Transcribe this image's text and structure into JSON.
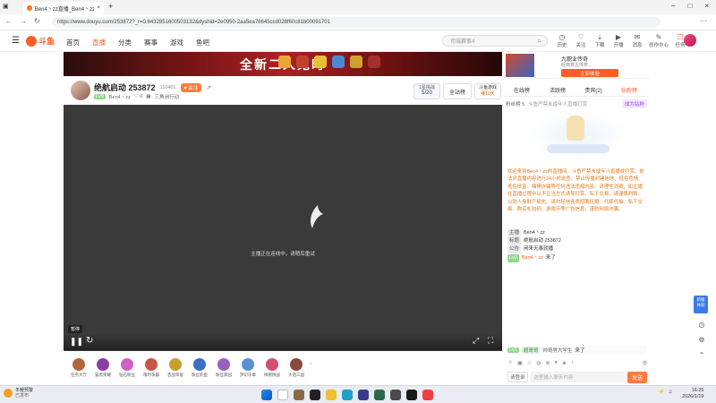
{
  "browser": {
    "tabs": [
      {
        "title": "Ben4丶zz直播_Ben4丶zz直播_Ben4丶",
        "active": true
      }
    ],
    "url": "https://www.douyu.com/253872?_r=0.6432851600503132&dyshid=2e0950-2aa5ea76645ccd028f60c81b00091701"
  },
  "header": {
    "logo": "斗鱼",
    "nav": [
      "首页",
      "直播",
      "分类",
      "赛事",
      "游戏",
      "鱼吧"
    ],
    "search_placeholder": "司瑞赛事4",
    "icons": [
      {
        "label": "历史",
        "icon": "clock-icon"
      },
      {
        "label": "关注",
        "icon": "heart-icon"
      },
      {
        "label": "下载",
        "icon": "download-icon"
      },
      {
        "label": "开播",
        "icon": "broadcast-icon"
      },
      {
        "label": "消息",
        "icon": "message-icon"
      },
      {
        "label": "创作中心",
        "icon": "create-icon"
      },
      {
        "label": "任务",
        "icon": "task-icon"
      }
    ]
  },
  "banner": {
    "text": "全新二人鬼时"
  },
  "stream": {
    "title": "绝航启动 253872",
    "room_id": "110401",
    "follow_label": "关注",
    "streamer": "Ben4丶zz",
    "level": "9",
    "category": "三角洲行动",
    "rank_label": "1星挑战",
    "rank_value": "5/20",
    "all_station_label": "全站榜",
    "fanclub_label": "斗鱼游戏",
    "fanclub_sub": "赛10天",
    "offline_text": "主播正在连线中，请稍后重试"
  },
  "controls": {
    "tooltip": "暂停"
  },
  "gifts": [
    {
      "label": "任务大厅",
      "color": "#b5653a"
    },
    {
      "label": "猫黑荣耀",
      "color": "#8a3fa6"
    },
    {
      "label": "钻石粉丝",
      "color": "#d060c8"
    },
    {
      "label": "限时争霸",
      "color": "#c9564a"
    },
    {
      "label": "百战荣誉",
      "color": "#c8a030"
    },
    {
      "label": "粉丝钓鱼",
      "color": "#3a70c4"
    },
    {
      "label": "粉丝家园",
      "color": "#9a60c0"
    },
    {
      "label": "梦幻乐章",
      "color": "#5b8fd8"
    },
    {
      "label": "稀愿挑战",
      "color": "#d05070"
    },
    {
      "label": "大话三国",
      "color": "#8a4a3a"
    }
  ],
  "sidepanel": {
    "ad_title": "九职业传奇",
    "ad_subtitle": "经典复古传奇...",
    "ad_button": "立即体验",
    "tabs": [
      "在线榜",
      "活跃榜",
      "贵宾(2)",
      "钻粉榜"
    ],
    "fans_row": "粉丝榜 5",
    "fans_banner": "斗鱼严禁未成年人直播打赏",
    "fans_join": "成为钻粉",
    "welcome_text": "欢迎来到Ben4丶zz的直播间。斗鱼严禁未成年人直播或打赏。依法对直播内容进行24小时巡查。禁止传播封建迷信、低俗色情、低俗炫富、赌博诈骗等任何违法违规内容。请理性消费，如主播在直播过程中以不正当方式诱导打赏、私下交易，请谨慎判断，以防人身财产损失。请勿轻信各类招聘征婚、代练代抽、私下交易、购买礼包码、游戏币等广告信息，谨防网络诈骗。",
    "info": [
      {
        "tag": "主播",
        "value": "Ben4丶zz"
      },
      {
        "tag": "标题",
        "value": "绝航启动 253872"
      },
      {
        "tag": "公告",
        "value": "闲来无事就播"
      }
    ],
    "join_msg": {
      "badge": "Lv2",
      "user": "Ben4丶zz",
      "action": "来了"
    },
    "chat_msg": {
      "badge": "Lv1",
      "tag": "超哥哥",
      "user": "帅哥男大学生",
      "action": "来了"
    },
    "chat_placeholder": "这里输入聊天内容",
    "send_label": "发送",
    "login_label": "请登录"
  },
  "taskbar": {
    "weather_temp": "冬暖预警",
    "weather_sub": "已发布",
    "time": "16:25",
    "date": "2026/1/19"
  }
}
